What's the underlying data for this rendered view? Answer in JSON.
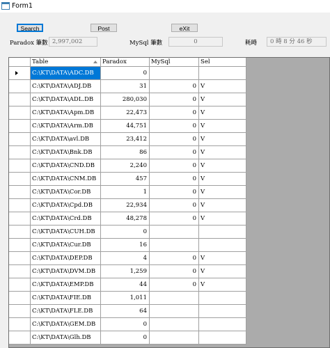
{
  "window": {
    "title": "Form1"
  },
  "toolbar": {
    "search_label": "Search",
    "post_label": "Post",
    "exit_label": "eXit"
  },
  "stats": {
    "paradox_label": "Paradox 筆數",
    "paradox_value": "2,997,002",
    "mysql_label": "MySql 筆數",
    "mysql_value": "0",
    "elapsed_label": "耗時",
    "elapsed_value": "0 時 8 分 46 秒"
  },
  "grid": {
    "columns": [
      "Table",
      "Paradox",
      "MySql",
      "Sel"
    ],
    "rows": [
      {
        "table": "C:\\KT\\DATA\\ADC.DB",
        "paradox": "0",
        "mysql": "",
        "sel": ""
      },
      {
        "table": "C:\\KT\\DATA\\ADJ.DB",
        "paradox": "31",
        "mysql": "0",
        "sel": "V"
      },
      {
        "table": "C:\\KT\\DATA\\ADL.DB",
        "paradox": "280,030",
        "mysql": "0",
        "sel": "V"
      },
      {
        "table": "C:\\KT\\DATA\\Apm.DB",
        "paradox": "22,473",
        "mysql": "0",
        "sel": "V"
      },
      {
        "table": "C:\\KT\\DATA\\Arm.DB",
        "paradox": "44,751",
        "mysql": "0",
        "sel": "V"
      },
      {
        "table": "C:\\KT\\DATA\\avl.DB",
        "paradox": "23,412",
        "mysql": "0",
        "sel": "V"
      },
      {
        "table": "C:\\KT\\DATA\\Bnk.DB",
        "paradox": "86",
        "mysql": "0",
        "sel": "V"
      },
      {
        "table": "C:\\KT\\DATA\\CND.DB",
        "paradox": "2,240",
        "mysql": "0",
        "sel": "V"
      },
      {
        "table": "C:\\KT\\DATA\\CNM.DB",
        "paradox": "457",
        "mysql": "0",
        "sel": "V"
      },
      {
        "table": "C:\\KT\\DATA\\Cor.DB",
        "paradox": "1",
        "mysql": "0",
        "sel": "V"
      },
      {
        "table": "C:\\KT\\DATA\\Cpd.DB",
        "paradox": "22,934",
        "mysql": "0",
        "sel": "V"
      },
      {
        "table": "C:\\KT\\DATA\\Crd.DB",
        "paradox": "48,278",
        "mysql": "0",
        "sel": "V"
      },
      {
        "table": "C:\\KT\\DATA\\CUH.DB",
        "paradox": "0",
        "mysql": "",
        "sel": ""
      },
      {
        "table": "C:\\KT\\DATA\\Cur.DB",
        "paradox": "16",
        "mysql": "",
        "sel": ""
      },
      {
        "table": "C:\\KT\\DATA\\DEP.DB",
        "paradox": "4",
        "mysql": "0",
        "sel": "V"
      },
      {
        "table": "C:\\KT\\DATA\\DVM.DB",
        "paradox": "1,259",
        "mysql": "0",
        "sel": "V"
      },
      {
        "table": "C:\\KT\\DATA\\EMP.DB",
        "paradox": "44",
        "mysql": "0",
        "sel": "V"
      },
      {
        "table": "C:\\KT\\DATA\\FIE.DB",
        "paradox": "1,011",
        "mysql": "",
        "sel": ""
      },
      {
        "table": "C:\\KT\\DATA\\FLE.DB",
        "paradox": "64",
        "mysql": "",
        "sel": ""
      },
      {
        "table": "C:\\KT\\DATA\\GEM.DB",
        "paradox": "0",
        "mysql": "",
        "sel": ""
      },
      {
        "table": "C:\\KT\\DATA\\Glh.DB",
        "paradox": "0",
        "mysql": "",
        "sel": ""
      }
    ]
  }
}
